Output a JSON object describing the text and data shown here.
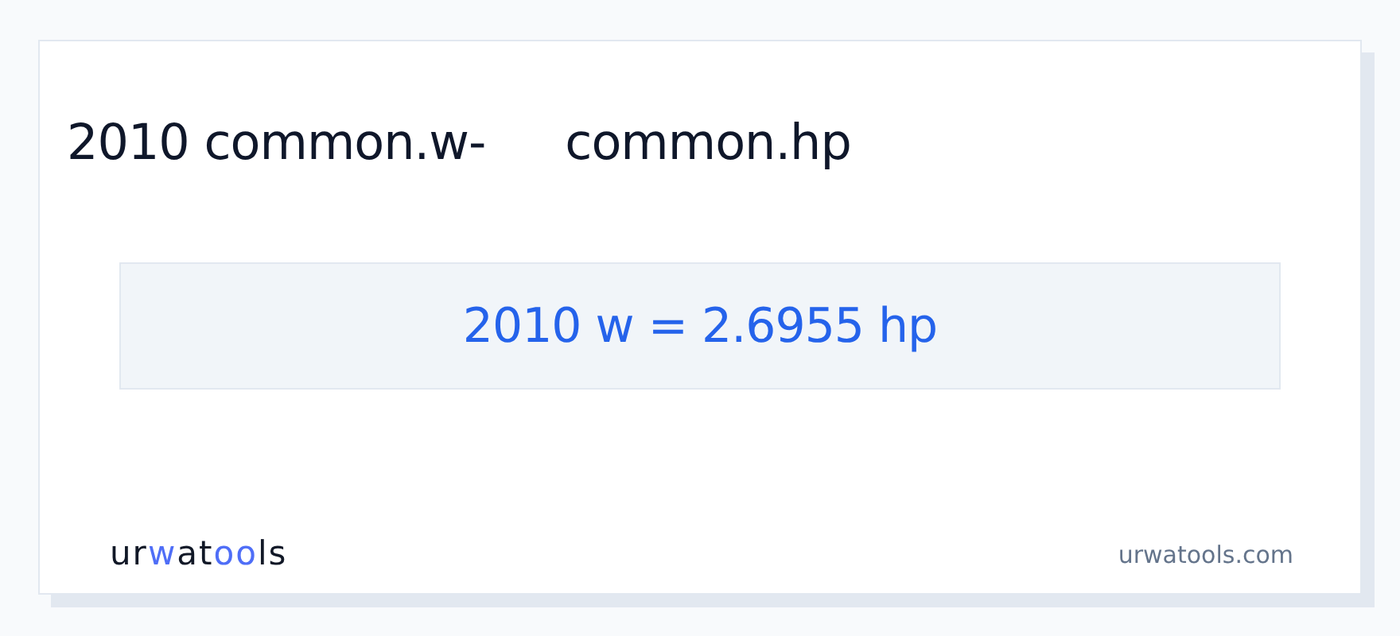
{
  "heading": {
    "parts": [
      "2010 common.w-",
      "common.hp"
    ]
  },
  "result": "2010 w = 2.6955 hp",
  "logo": {
    "parts": [
      {
        "text": "ur",
        "accent": false
      },
      {
        "text": "w",
        "accent": true
      },
      {
        "text": "at",
        "accent": false
      },
      {
        "text": "oo",
        "accent": true
      },
      {
        "text": "ls",
        "accent": false
      }
    ]
  },
  "site": "urwatools.com"
}
